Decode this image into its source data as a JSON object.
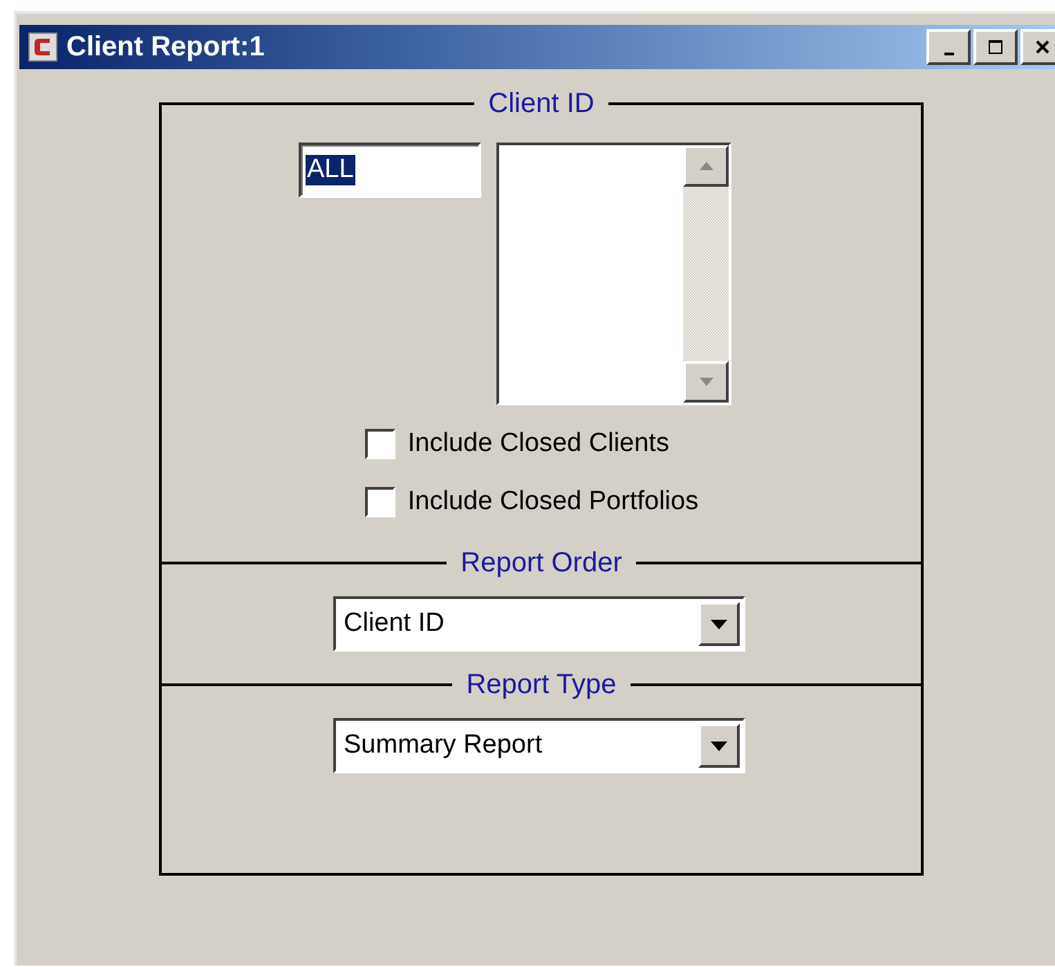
{
  "window": {
    "title": "Client Report:1"
  },
  "sections": [
    {
      "title": "Client ID"
    },
    {
      "title": "Report Order"
    },
    {
      "title": "Report Type"
    }
  ],
  "client_id_field": {
    "value": "ALL",
    "selected": true
  },
  "checkboxes": [
    {
      "label": "Include Closed Clients",
      "checked": false
    },
    {
      "label": "Include Closed Portfolios",
      "checked": false
    }
  ],
  "report_order": {
    "value": "Client ID"
  },
  "report_type": {
    "value": "Summary Report"
  }
}
